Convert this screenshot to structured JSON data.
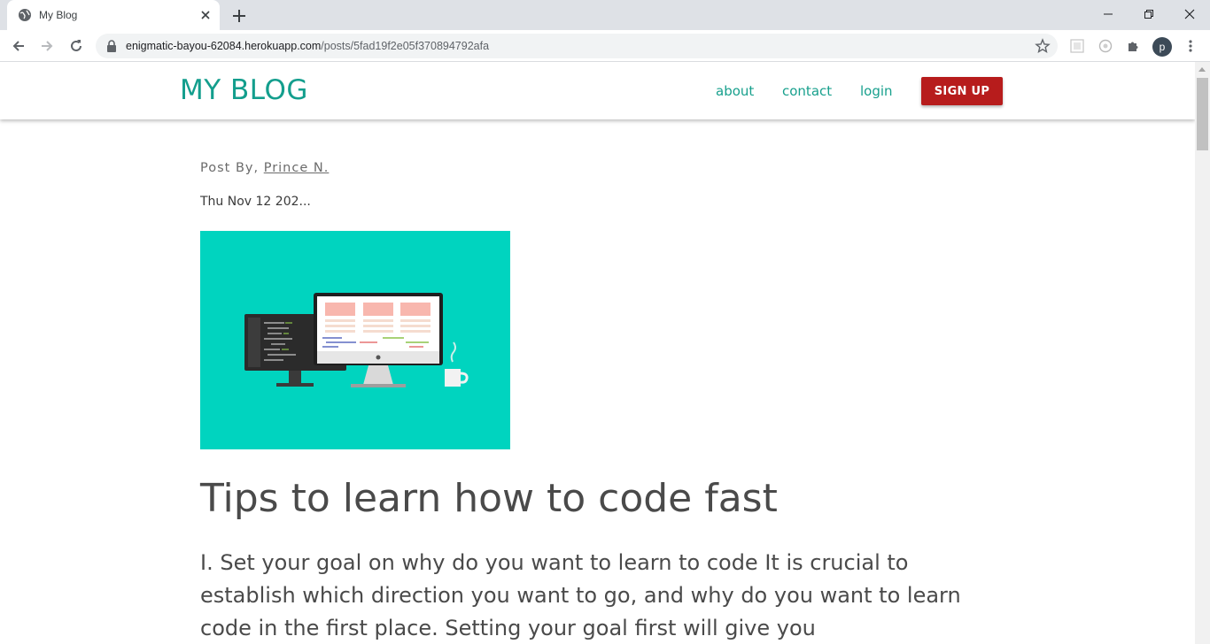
{
  "browser": {
    "tab_title": "My Blog",
    "url_host": "enigmatic-bayou-62084.herokuapp.com",
    "url_path": "/posts/5fad19f2e05f370894792afa",
    "profile_initial": "p"
  },
  "site": {
    "brand": "MY BLOG",
    "nav": {
      "about": "about",
      "contact": "contact",
      "login": "login"
    },
    "signup_label": "SIGN UP",
    "colors": {
      "brand": "#139e8d",
      "signup": "#b71c1c",
      "hero": "#00d4bf"
    }
  },
  "post": {
    "by_prefix": "Post By,",
    "author": "Prince N.",
    "date": "Thu Nov 12 202...",
    "title": "Tips to learn how to code fast",
    "body": "I. Set your goal on why do you want to learn to code It is crucial to establish which direction you want to go, and why do you want to learn code in the first place. Setting your goal first will give you"
  }
}
